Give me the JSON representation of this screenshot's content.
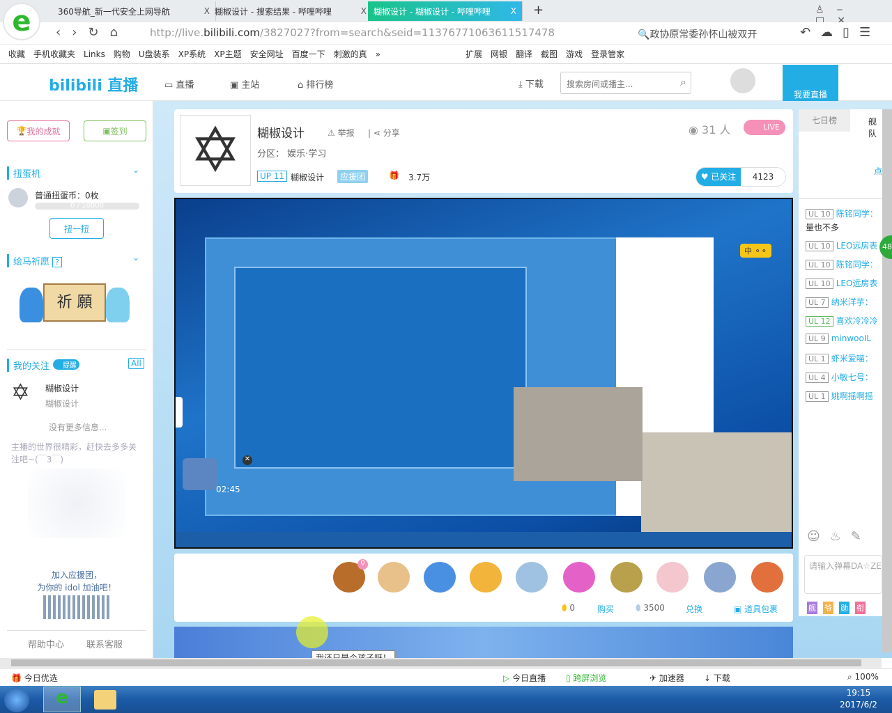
{
  "browser": {
    "tabs": [
      {
        "title": "360导航_新一代安全上网导航",
        "close": "X"
      },
      {
        "title": "糊椒设计 - 搜索结果 - 哔哩哔哩",
        "close": "X"
      },
      {
        "title": "糊椒设计 - 糊椒设计 - 哔哩哔哩",
        "close": "X",
        "active": true
      }
    ],
    "new_tab": "+",
    "url_prefix": "http://live.",
    "url_domain": "bilibili.com",
    "url_rest": "/3827027?from=search&seid=11376771063611517478",
    "search_hint": "政协原常委孙怀山被双开",
    "bookmarks": [
      "收藏",
      "手机收藏夹",
      "Links",
      "购物",
      "U盘装系",
      "XP系统",
      "XP主题",
      "安全网址",
      "百度一下",
      "刺激的真",
      "»"
    ],
    "extensions": [
      "扩展",
      "网银",
      "翻译",
      "截图",
      "游戏",
      "登录管家"
    ]
  },
  "header": {
    "logo": "bilibili 直播",
    "nav": [
      "直播",
      "主站",
      "排行榜"
    ],
    "download": "下载",
    "search_placeholder": "搜索房间或播主...",
    "go_live": "我要直播"
  },
  "sidebar": {
    "achievement": "我的成就",
    "checkin": "签到",
    "gacha_title": "扭蛋机",
    "gacha_coins": "普通扭蛋币：0枚",
    "gacha_progress": "0 / 10000",
    "gacha_progress_value": 0,
    "gacha_button": "扭一扭",
    "wish_title": "绘马祈愿",
    "wish_help": "?",
    "wish_image_text": "祈 願",
    "follow_title": "我的关注",
    "follow_toggle": "提醒",
    "follow_all": "All",
    "follow_name": "糊椒设计",
    "follow_sub": "糊椒设计",
    "no_more": "没有更多信息...",
    "hint": "主播的世界很精彩，赶快去多多关注吧~(￣3￣)",
    "join_line1": "加入应援团，",
    "join_line2": "为你的 idol 加油吧！",
    "help": "帮助中心",
    "contact": "联系客服"
  },
  "room": {
    "title": "糊椒设计",
    "report": "举报",
    "share": "分享",
    "category": "分区： 娱乐·学习",
    "up_level": "UP 11",
    "up_name": "糊椒设计",
    "fan_club": "应援团",
    "gifts": "3.7万",
    "viewers": "31 人",
    "live": "LIVE",
    "followed": "已关注",
    "followers": "4123",
    "timer": "02:45"
  },
  "giftbar": {
    "badge": "0",
    "gold": "0",
    "buy": "购买",
    "silver": "3500",
    "exchange": "兑换",
    "package": "道具包裹"
  },
  "tooltip": "我还只是个孩子呀！",
  "right": {
    "tabs": [
      "七日榜",
      "舰队"
    ],
    "dot": "点",
    "badge": "48",
    "chat": [
      {
        "lv": "UL 10",
        "user": "陈铭同学：",
        "text": "量也不多"
      },
      {
        "lv": "UL 10",
        "user": "LEO远房表"
      },
      {
        "lv": "UL 10",
        "user": "陈铭同学："
      },
      {
        "lv": "UL 10",
        "user": "LEO远房表"
      },
      {
        "lv": "UL 7",
        "user": "纳米洋芋："
      },
      {
        "lv": "UL 12",
        "user": "喜欢冷冷冷",
        "green": true
      },
      {
        "lv": "UL 9",
        "user": "minwooIL"
      },
      {
        "lv": "UL 1",
        "user": "虾米爱喵："
      },
      {
        "lv": "UL 4",
        "user": "小敏七号："
      },
      {
        "lv": "UL 1",
        "user": "姚啊摇啊摇"
      }
    ],
    "input_placeholder": "请输入弹幕DA☆ZE",
    "badges": [
      "舰",
      "爷",
      "勋",
      "衔"
    ]
  },
  "status": {
    "left": "今日优选",
    "items": [
      "今日直播",
      "跨屏浏览",
      "加速器",
      "下载"
    ],
    "zoom": "100%"
  },
  "taskbar": {
    "time": "19:15",
    "date": "2017/6/2"
  }
}
